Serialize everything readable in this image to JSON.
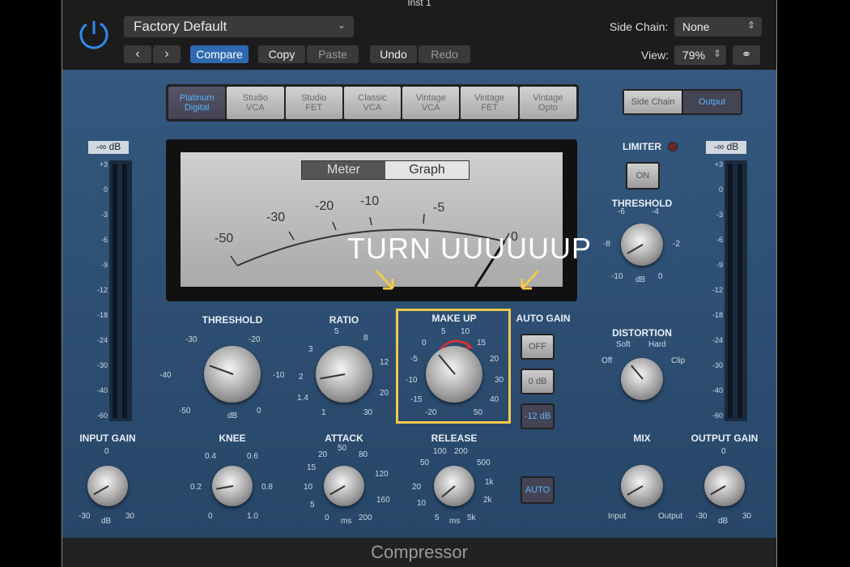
{
  "window": {
    "title": "Inst 1"
  },
  "header": {
    "preset": "Factory Default",
    "compare_label": "Compare",
    "copy_label": "Copy",
    "paste_label": "Paste",
    "undo_label": "Undo",
    "redo_label": "Redo",
    "side_chain_label": "Side Chain:",
    "side_chain_value": "None",
    "view_label": "View:",
    "view_value": "79%"
  },
  "models": [
    "Platinum\nDigital",
    "Studio\nVCA",
    "Studio\nFET",
    "Classic\nVCA",
    "Vintage\nVCA",
    "Vintage\nFET",
    "Vintage\nOpto"
  ],
  "meter": {
    "toggle_meter": "Meter",
    "toggle_graph": "Graph",
    "scale": [
      "-50",
      "-30",
      "-20",
      "-10",
      "-5",
      "0"
    ]
  },
  "knobs": {
    "threshold": {
      "label": "THRESHOLD",
      "ticks": [
        "-30",
        "-20",
        "-40",
        "-10",
        "-50",
        "0",
        "dB"
      ]
    },
    "ratio": {
      "label": "RATIO",
      "ticks": [
        "5",
        "8",
        "3",
        "12",
        "2",
        "20",
        "1.4",
        "1",
        "30"
      ]
    },
    "makeup": {
      "label": "MAKE UP",
      "ticks": [
        "5",
        "10",
        "0",
        "15",
        "-5",
        "20",
        "-10",
        "30",
        "-15",
        "40",
        "-20",
        "50"
      ]
    },
    "knee": {
      "label": "KNEE",
      "ticks": [
        "0.4",
        "0.6",
        "0.2",
        "0.8",
        "0",
        "1.0"
      ]
    },
    "attack": {
      "label": "ATTACK",
      "ticks": [
        "20",
        "50",
        "80",
        "15",
        "120",
        "10",
        "160",
        "5",
        "0",
        "ms",
        "200"
      ]
    },
    "release": {
      "label": "RELEASE",
      "ticks": [
        "100",
        "200",
        "50",
        "500",
        "1k",
        "20",
        "2k",
        "10",
        "5",
        "ms",
        "5k"
      ]
    },
    "input_gain": {
      "label": "INPUT GAIN",
      "ticks": [
        "0",
        "-30",
        "dB",
        "30"
      ]
    },
    "output_gain": {
      "label": "OUTPUT GAIN",
      "ticks": [
        "0",
        "-30",
        "dB",
        "30"
      ]
    },
    "limiter_threshold": {
      "label": "THRESHOLD",
      "ticks": [
        "-6",
        "-4",
        "-8",
        "-2",
        "-10",
        "dB",
        "0"
      ]
    },
    "distortion": {
      "label": "DISTORTION",
      "ticks": [
        "Soft",
        "Hard",
        "Off",
        "Clip"
      ]
    },
    "mix": {
      "label": "MIX",
      "ticks": [
        "Input",
        "Output"
      ]
    }
  },
  "auto_gain": {
    "label": "AUTO GAIN",
    "off": "OFF",
    "zero": "0 dB",
    "minus12": "-12 dB"
  },
  "auto_button": "AUTO",
  "limiter": {
    "label": "LIMITER",
    "on": "ON"
  },
  "side_chain_btn": "Side Chain",
  "output_btn": "Output",
  "meter_readout": "-∞ dB",
  "meter_scale": [
    "+3",
    "0",
    "-3",
    "-6",
    "-9",
    "-12",
    "-18",
    "-24",
    "-30",
    "-40",
    "-60"
  ],
  "annotation": "TURN UUUUUUP",
  "footer": "Compressor",
  "colors": {
    "panel": "#2f5279",
    "accent": "#5ab4ff",
    "highlight": "#f2c94c"
  }
}
